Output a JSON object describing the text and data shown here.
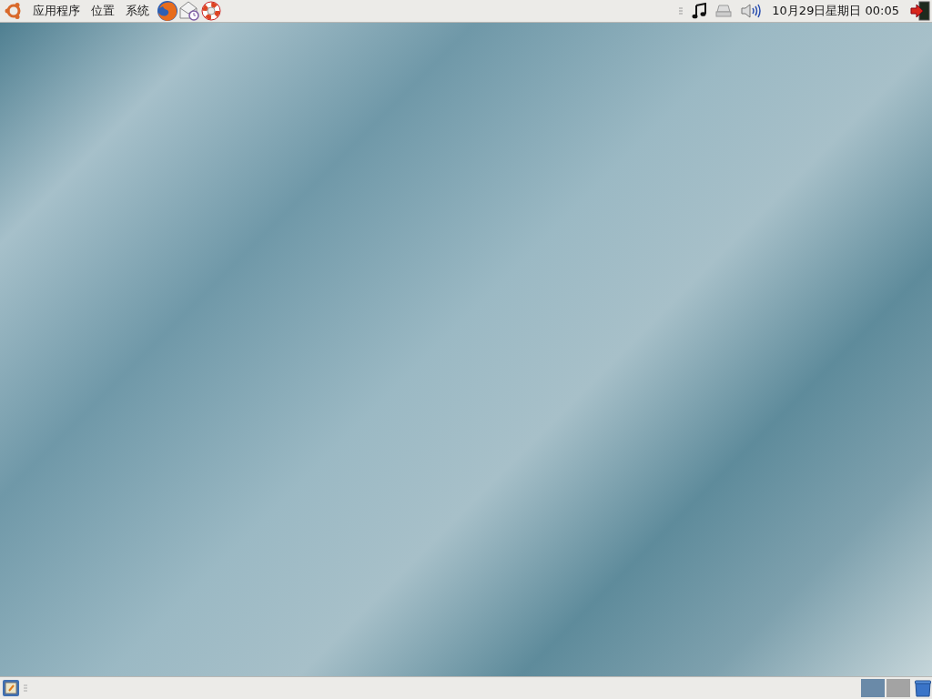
{
  "top_panel": {
    "menus": [
      {
        "label": "应用程序"
      },
      {
        "label": "位置"
      },
      {
        "label": "系统"
      }
    ],
    "clock": "10月29日星期日 00:05"
  },
  "bottom_panel": {
    "workspaces": [
      {
        "selected": true
      },
      {
        "selected": false
      }
    ]
  }
}
